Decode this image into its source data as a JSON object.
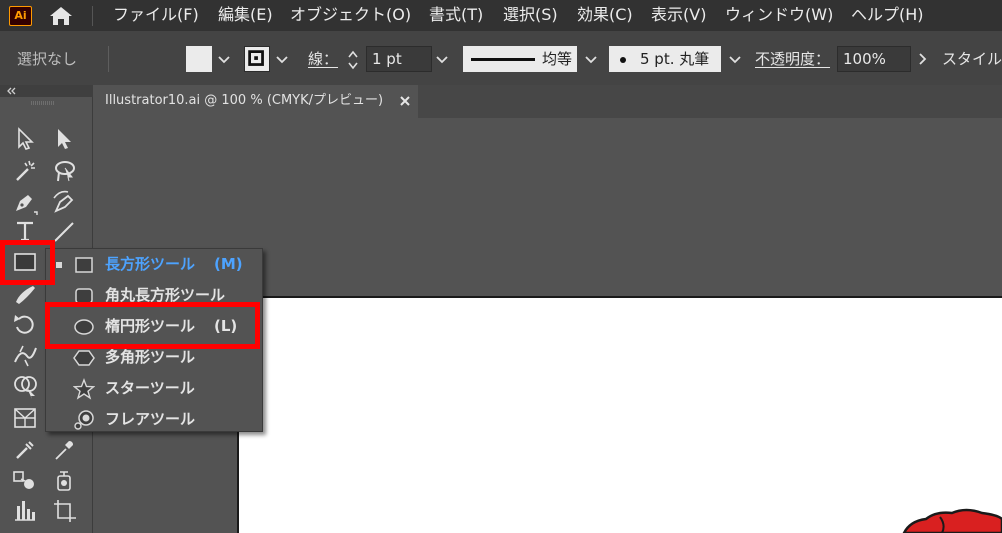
{
  "app": {
    "logo_text": "Ai",
    "accent": "#ff9a00"
  },
  "menu": {
    "items": [
      "ファイル(F)",
      "編集(E)",
      "オブジェクト(O)",
      "書式(T)",
      "選択(S)",
      "効果(C)",
      "表示(V)",
      "ウィンドウ(W)",
      "ヘルプ(H)"
    ]
  },
  "control_bar": {
    "selection_label": "選択なし",
    "stroke_label": "線：",
    "stroke_weight": "1 pt",
    "stroke_profile_label": "均等",
    "brush_label": "5 pt. 丸筆",
    "opacity_label": "不透明度：",
    "opacity_value": "100%",
    "style_label": "スタイル"
  },
  "document_tab": {
    "title": "Illustrator10.ai @ 100 % (CMYK/プレビュー)",
    "close_glyph": "×"
  },
  "flyout": {
    "items": [
      {
        "label": "長方形ツール",
        "shortcut": "(M)",
        "icon": "rectangle-icon",
        "active": true
      },
      {
        "label": "角丸長方形ツール",
        "shortcut": "",
        "icon": "rounded-rectangle-icon",
        "active": false
      },
      {
        "label": "楕円形ツール",
        "shortcut": "(L)",
        "icon": "ellipse-icon",
        "active": false
      },
      {
        "label": "多角形ツール",
        "shortcut": "",
        "icon": "polygon-icon",
        "active": false
      },
      {
        "label": "スターツール",
        "shortcut": "",
        "icon": "star-icon",
        "active": false
      },
      {
        "label": "フレアツール",
        "shortcut": "",
        "icon": "flare-icon",
        "active": false
      }
    ]
  },
  "colors": {
    "highlight": "#ff0000",
    "active_menu_text": "#4da3ff",
    "menubar_bg": "#323232",
    "panel_bg": "#535353"
  }
}
